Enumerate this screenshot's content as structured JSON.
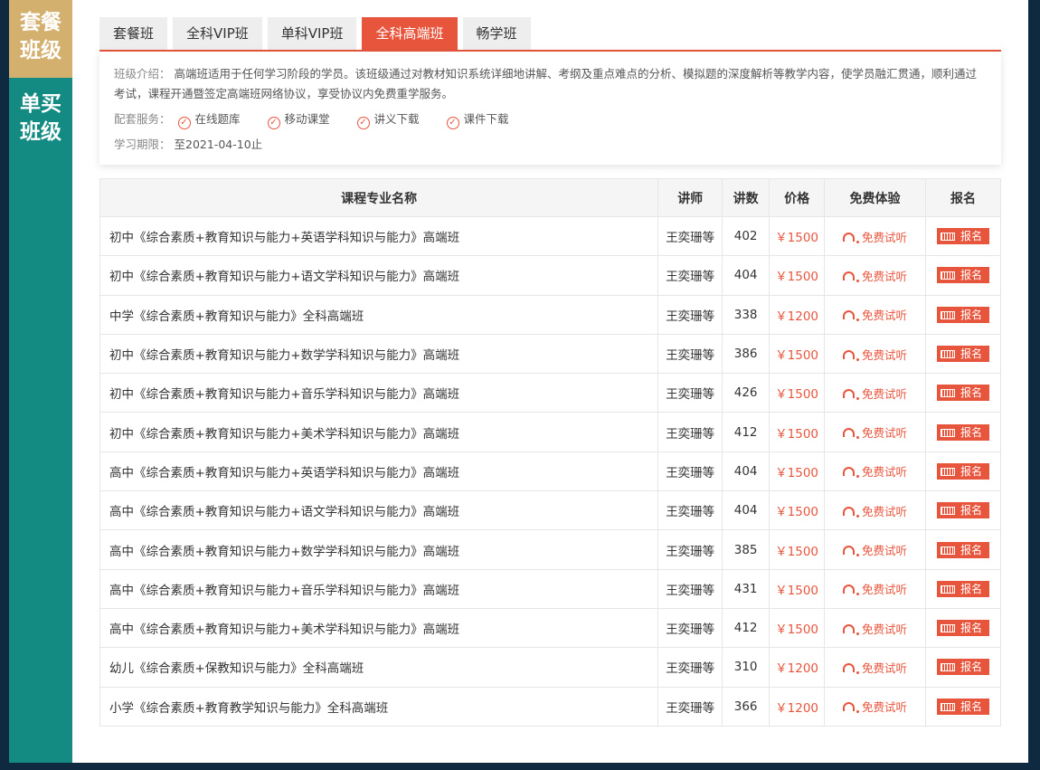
{
  "sidebar": {
    "items": [
      {
        "line1": "套餐",
        "line2": "班级"
      },
      {
        "line1": "单买",
        "line2": "班级"
      }
    ]
  },
  "tabs": [
    "套餐班",
    "全科VIP班",
    "单科VIP班",
    "全科高端班",
    "畅学班"
  ],
  "active_tab": 3,
  "info": {
    "intro_label": "班级介绍：",
    "intro_text": "高端班适用于任何学习阶段的学员。该班级通过对教材知识系统详细地讲解、考纲及重点难点的分析、模拟题的深度解析等教学内容，使学员融汇贯通，顺利通过考试，课程开通暨签定高端班网络协议，享受协议内免费重学服务。",
    "services_label": "配套服务：",
    "services": [
      "在线题库",
      "移动课堂",
      "讲义下载",
      "课件下载"
    ],
    "period_label": "学习期限：",
    "period_value": "至2021-04-10止"
  },
  "table": {
    "headers": [
      "课程专业名称",
      "讲师",
      "讲数",
      "价格",
      "免费体验",
      "报名"
    ],
    "trial_label": "免费试听",
    "enroll_label": "报名",
    "rows": [
      {
        "name": "初中《综合素质+教育知识与能力+英语学科知识与能力》高端班",
        "teacher": "王奕珊等",
        "lessons": "402",
        "price": "￥1500"
      },
      {
        "name": "初中《综合素质+教育知识与能力+语文学科知识与能力》高端班",
        "teacher": "王奕珊等",
        "lessons": "404",
        "price": "￥1500"
      },
      {
        "name": "中学《综合素质+教育知识与能力》全科高端班",
        "teacher": "王奕珊等",
        "lessons": "338",
        "price": "￥1200"
      },
      {
        "name": "初中《综合素质+教育知识与能力+数学学科知识与能力》高端班",
        "teacher": "王奕珊等",
        "lessons": "386",
        "price": "￥1500"
      },
      {
        "name": "初中《综合素质+教育知识与能力+音乐学科知识与能力》高端班",
        "teacher": "王奕珊等",
        "lessons": "426",
        "price": "￥1500"
      },
      {
        "name": "初中《综合素质+教育知识与能力+美术学科知识与能力》高端班",
        "teacher": "王奕珊等",
        "lessons": "412",
        "price": "￥1500"
      },
      {
        "name": "高中《综合素质+教育知识与能力+英语学科知识与能力》高端班",
        "teacher": "王奕珊等",
        "lessons": "404",
        "price": "￥1500"
      },
      {
        "name": "高中《综合素质+教育知识与能力+语文学科知识与能力》高端班",
        "teacher": "王奕珊等",
        "lessons": "404",
        "price": "￥1500"
      },
      {
        "name": "高中《综合素质+教育知识与能力+数学学科知识与能力》高端班",
        "teacher": "王奕珊等",
        "lessons": "385",
        "price": "￥1500"
      },
      {
        "name": "高中《综合素质+教育知识与能力+音乐学科知识与能力》高端班",
        "teacher": "王奕珊等",
        "lessons": "431",
        "price": "￥1500"
      },
      {
        "name": "高中《综合素质+教育知识与能力+美术学科知识与能力》高端班",
        "teacher": "王奕珊等",
        "lessons": "412",
        "price": "￥1500"
      },
      {
        "name": "幼儿《综合素质+保教知识与能力》全科高端班",
        "teacher": "王奕珊等",
        "lessons": "310",
        "price": "￥1200"
      },
      {
        "name": "小学《综合素质+教育教学知识与能力》全科高端班",
        "teacher": "王奕珊等",
        "lessons": "366",
        "price": "￥1200"
      }
    ]
  },
  "colors": {
    "accent": "#e8553d",
    "sidebar": "#138a82",
    "sidebar_active": "#d4b06e",
    "frame": "#0e2940"
  }
}
